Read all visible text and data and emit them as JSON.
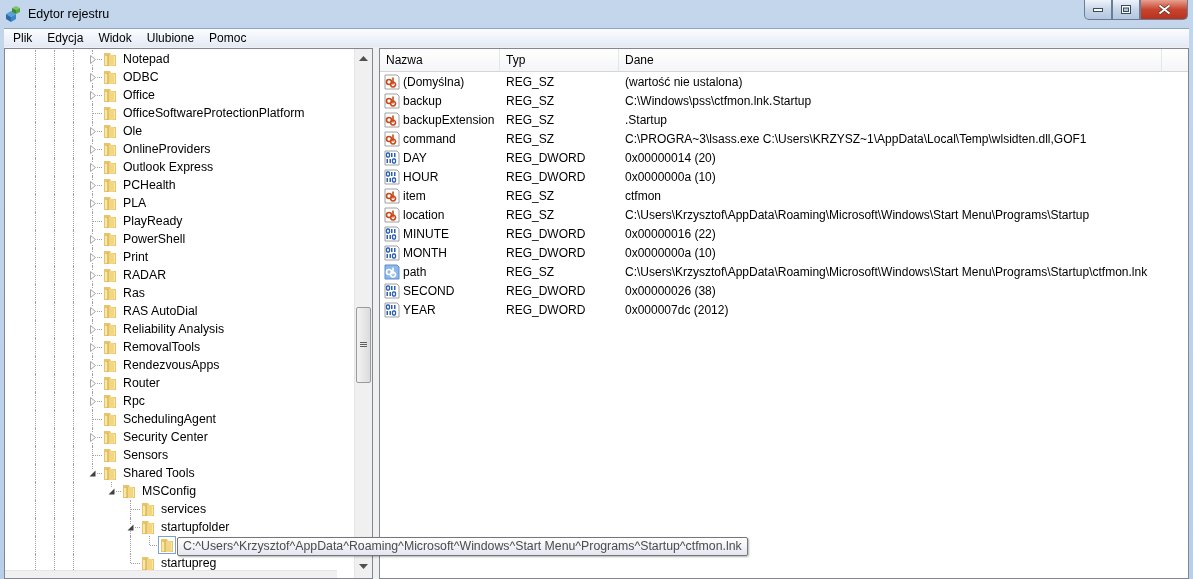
{
  "window": {
    "title": "Edytor rejestru"
  },
  "menu": [
    "Plik",
    "Edycja",
    "Widok",
    "Ulubione",
    "Pomoc"
  ],
  "tree": [
    {
      "label": "Notepad",
      "expanded": false
    },
    {
      "label": "ODBC",
      "expanded": false
    },
    {
      "label": "Office",
      "expanded": false
    },
    {
      "label": "OfficeSoftwareProtectionPlatform"
    },
    {
      "label": "Ole",
      "expanded": false
    },
    {
      "label": "OnlineProviders",
      "expanded": false
    },
    {
      "label": "Outlook Express",
      "expanded": false
    },
    {
      "label": "PCHealth",
      "expanded": false
    },
    {
      "label": "PLA",
      "expanded": false
    },
    {
      "label": "PlayReady"
    },
    {
      "label": "PowerShell",
      "expanded": false
    },
    {
      "label": "Print",
      "expanded": false
    },
    {
      "label": "RADAR",
      "expanded": false
    },
    {
      "label": "Ras",
      "expanded": false
    },
    {
      "label": "RAS AutoDial",
      "expanded": false
    },
    {
      "label": "Reliability Analysis",
      "expanded": false
    },
    {
      "label": "RemovalTools",
      "expanded": false
    },
    {
      "label": "RendezvousApps",
      "expanded": false
    },
    {
      "label": "Router",
      "expanded": false
    },
    {
      "label": "Rpc",
      "expanded": false
    },
    {
      "label": "SchedulingAgent"
    },
    {
      "label": "Security Center",
      "expanded": false
    },
    {
      "label": "Sensors"
    },
    {
      "label": "Shared Tools",
      "expanded": true,
      "children": [
        {
          "label": "MSConfig",
          "expanded": true,
          "children": [
            {
              "label": "services"
            },
            {
              "label": "startupfolder",
              "expanded": true,
              "children": [
                {
                  "label": "C:^Users^Krzysztof^AppData^Roaming^Microsoft^Windows^Start Menu^Programs^Startup^ctfmon.lnk",
                  "hovered": true
                }
              ]
            },
            {
              "label": "startupreg"
            }
          ]
        }
      ]
    }
  ],
  "values": {
    "columns": [
      "Nazwa",
      "Typ",
      "Dane"
    ],
    "rows": [
      {
        "name": "(Domyślna)",
        "type": "REG_SZ",
        "data": "(wartość nie ustalona)",
        "kind": "string",
        "selected": false
      },
      {
        "name": "backup",
        "type": "REG_SZ",
        "data": "C:\\Windows\\pss\\ctfmon.lnk.Startup",
        "kind": "string",
        "selected": false
      },
      {
        "name": "backupExtension",
        "type": "REG_SZ",
        "data": ".Startup",
        "kind": "string",
        "selected": false
      },
      {
        "name": "command",
        "type": "REG_SZ",
        "data": "C:\\PROGRA~3\\lsass.exe C:\\Users\\KRZYSZ~1\\AppData\\Local\\Temp\\wlsidten.dll,GOF1",
        "kind": "string",
        "selected": false
      },
      {
        "name": "DAY",
        "type": "REG_DWORD",
        "data": "0x00000014 (20)",
        "kind": "binary",
        "selected": false
      },
      {
        "name": "HOUR",
        "type": "REG_DWORD",
        "data": "0x0000000a (10)",
        "kind": "binary",
        "selected": false
      },
      {
        "name": "item",
        "type": "REG_SZ",
        "data": "ctfmon",
        "kind": "string",
        "selected": false
      },
      {
        "name": "location",
        "type": "REG_SZ",
        "data": "C:\\Users\\Krzysztof\\AppData\\Roaming\\Microsoft\\Windows\\Start Menu\\Programs\\Startup",
        "kind": "string",
        "selected": false
      },
      {
        "name": "MINUTE",
        "type": "REG_DWORD",
        "data": "0x00000016 (22)",
        "kind": "binary",
        "selected": false
      },
      {
        "name": "MONTH",
        "type": "REG_DWORD",
        "data": "0x0000000a (10)",
        "kind": "binary",
        "selected": false
      },
      {
        "name": "path",
        "type": "REG_SZ",
        "data": "C:\\Users\\Krzysztof\\AppData\\Roaming\\Microsoft\\Windows\\Start Menu\\Programs\\Startup\\ctfmon.lnk",
        "kind": "string",
        "selected": true
      },
      {
        "name": "SECOND",
        "type": "REG_DWORD",
        "data": "0x00000026 (38)",
        "kind": "binary",
        "selected": false
      },
      {
        "name": "YEAR",
        "type": "REG_DWORD",
        "data": "0x000007dc (2012)",
        "kind": "binary",
        "selected": false
      }
    ]
  }
}
